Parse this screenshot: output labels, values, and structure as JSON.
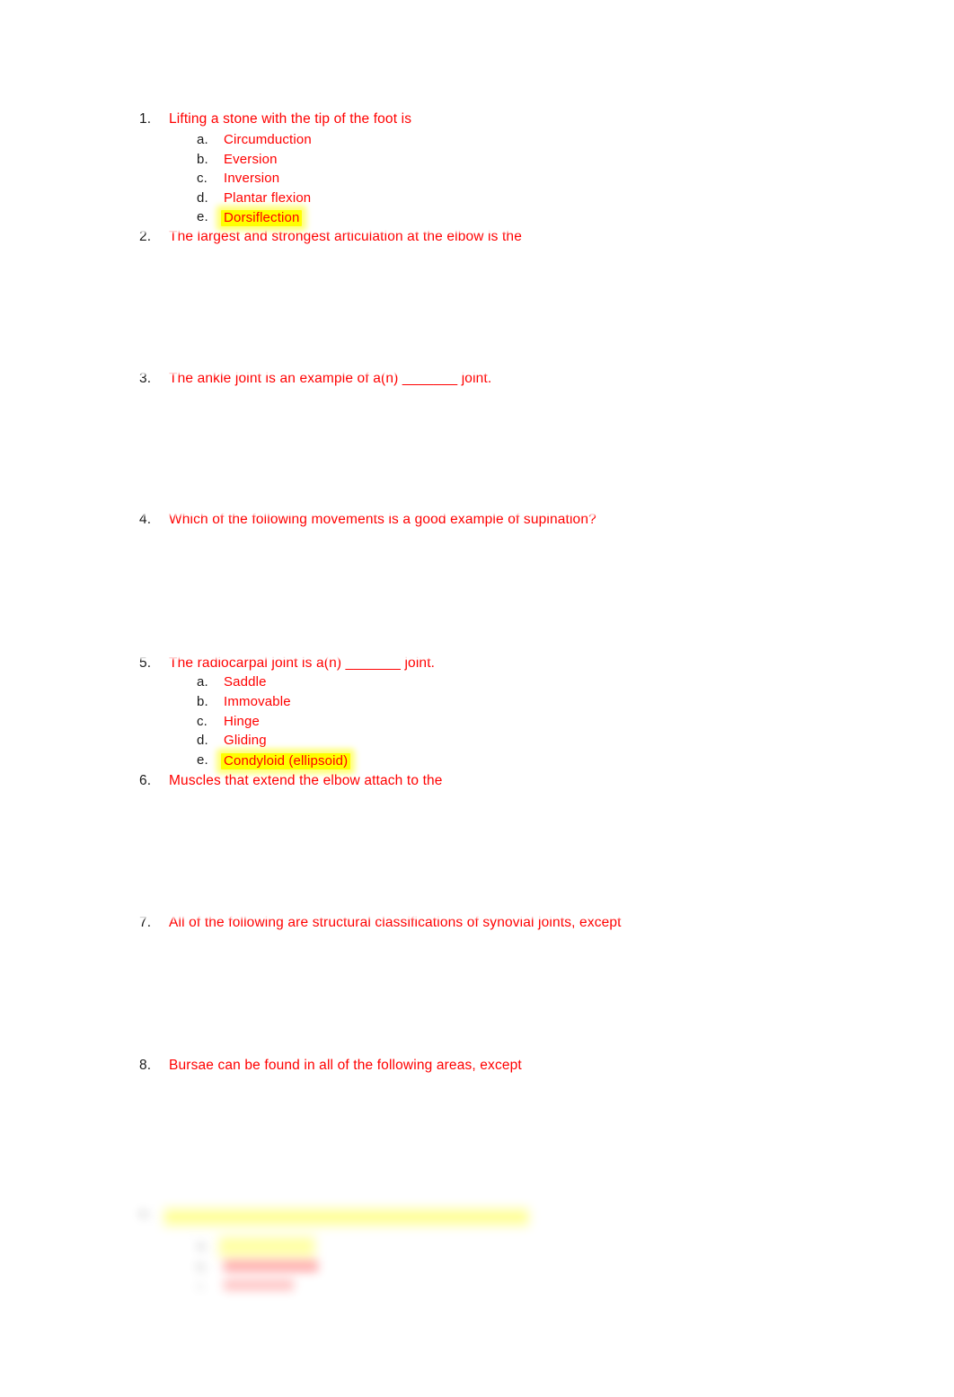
{
  "document": {
    "page_background": "#ffffff",
    "text_color": "#ff0000",
    "marker_color": "#1a1a1a",
    "highlight_color": "#ffff00"
  },
  "questions": [
    {
      "marker": "1.",
      "text": "Lifting a stone with the tip of the foot is",
      "answers": [
        {
          "marker": "a.",
          "text": "Circumduction",
          "highlighted": false
        },
        {
          "marker": "b.",
          "text": "Eversion",
          "highlighted": false
        },
        {
          "marker": "c.",
          "text": "Inversion",
          "highlighted": false
        },
        {
          "marker": "d.",
          "text": "Plantar flexion",
          "highlighted": false
        },
        {
          "marker": "e.",
          "text": "Dorsiflection",
          "highlighted": true
        }
      ]
    },
    {
      "marker": "2.",
      "text": "The largest and strongest articulation at the elbow is the",
      "answers": []
    },
    {
      "marker": "3.",
      "text": "The ankle joint is an example of a(n) _______ joint.",
      "answers": []
    },
    {
      "marker": "4.",
      "text": "Which of the following movements is a good example of supination?",
      "answers": []
    },
    {
      "marker": "5.",
      "text": "The radiocarpal joint is a(n) _______ joint.",
      "answers": [
        {
          "marker": "a.",
          "text": "Saddle",
          "highlighted": false
        },
        {
          "marker": "b.",
          "text": "Immovable",
          "highlighted": false
        },
        {
          "marker": "c.",
          "text": "Hinge",
          "highlighted": false
        },
        {
          "marker": "d.",
          "text": "Gliding",
          "highlighted": false
        },
        {
          "marker": "e.",
          "text": "Condyloid (ellipsoid)",
          "highlighted": true
        }
      ]
    },
    {
      "marker": "6.",
      "text": "Muscles that extend the elbow attach to the",
      "answers": []
    },
    {
      "marker": "7.",
      "text": "All of the following are structural classifications of synovial joints, except",
      "answers": []
    },
    {
      "marker": "8.",
      "text": "Bursae can be found in all of the following areas, except",
      "answers": []
    }
  ],
  "faded_block": {
    "question": {
      "marker": "9.",
      "text": " "
    },
    "answers": [
      {
        "marker": "a.",
        "text": " ",
        "highlighted": true
      },
      {
        "marker": "b.",
        "text": " ",
        "highlighted": false
      },
      {
        "marker": "c.",
        "text": " ",
        "highlighted": false
      }
    ]
  }
}
